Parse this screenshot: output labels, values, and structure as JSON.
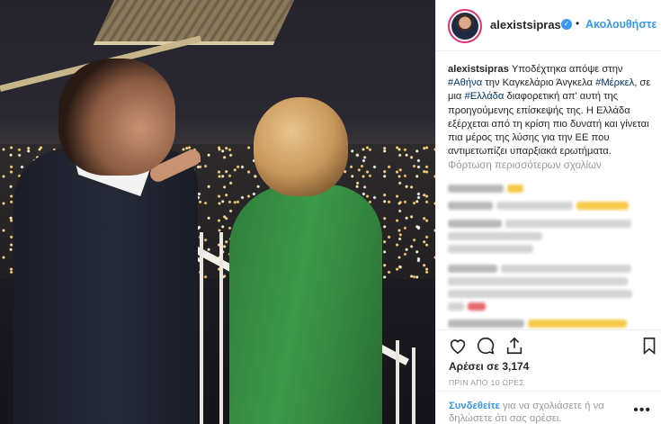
{
  "post": {
    "username": "alexistsipras",
    "follow_label": "Ακολουθήστε",
    "separator": "•",
    "verified_glyph": "✓"
  },
  "caption": {
    "user": "alexistsipras",
    "text_1": " Υποδέχτηκα απόψε στην ",
    "tag_1": "#Αθήνα",
    "text_2": " την Καγκελάριο Άνγκελα ",
    "tag_2": "#Μέρκελ",
    "text_3": ", σε μια ",
    "tag_3": "#Ελλάδα",
    "text_4": " διαφορετική απ' αυτή της προηγούμενης επίσκεψής της. Η Ελλάδα εξέρχεται από τη κρίση πιο δυνατή και γίνεται πια μέρος της λύσης για την ΕΕ που αντιμετωπίζει υπαρξιακά ερωτήματα."
  },
  "comments": {
    "load_more": "Φόρτωση περισσότερων σχολίων"
  },
  "stats": {
    "likes": "Αρέσει σε 3,174",
    "time": "ΠΡΙΝ ΑΠΟ 10 ΩΡΕΣ"
  },
  "login": {
    "link": "Συνδεθείτε",
    "rest": " για να σχολιάσετε ή να δηλώσετε ότι σας αρέσει.",
    "more": "•••"
  },
  "icons": [
    "heart-icon",
    "comment-icon",
    "share-icon",
    "bookmark-icon"
  ],
  "colors": {
    "link_blue": "#3897f0",
    "tag_blue": "#003569",
    "muted": "#999999"
  }
}
